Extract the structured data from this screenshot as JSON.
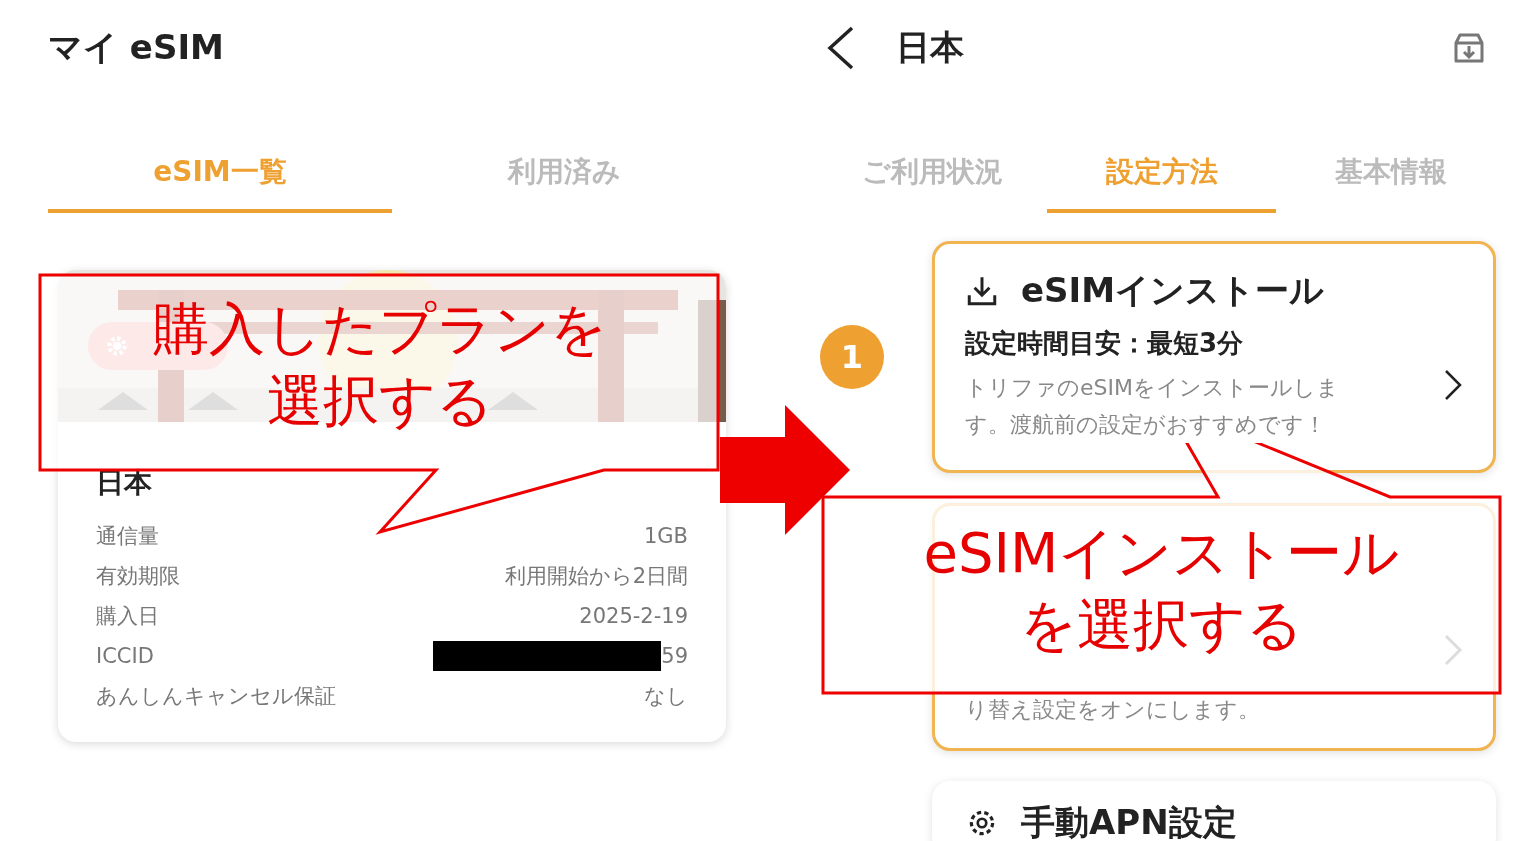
{
  "left": {
    "title": "マイ eSIM",
    "tabs": [
      {
        "label": "eSIM一覧",
        "selected": true
      },
      {
        "label": "利用済み",
        "selected": false
      }
    ],
    "plan_card": {
      "country": "日本",
      "rows": [
        {
          "kind": "text",
          "label": "通信量",
          "value": "1GB"
        },
        {
          "kind": "text",
          "label": "有効期限",
          "value": "利用開始から2日間"
        },
        {
          "kind": "text",
          "label": "購入日",
          "value": "2025-2-19"
        },
        {
          "kind": "redacted",
          "label": "ICCID",
          "value": "59"
        },
        {
          "kind": "text",
          "label": "あんしんキャンセル保証",
          "value": "なし"
        }
      ]
    }
  },
  "right": {
    "title": "日本",
    "tabs": [
      {
        "label": "ご利用状況",
        "selected": false
      },
      {
        "label": "設定方法",
        "selected": true
      },
      {
        "label": "基本情報",
        "selected": false
      }
    ],
    "steps": [
      {
        "kind": "install",
        "number": "1",
        "title": "eSIMインストール",
        "time": "設定時間目安：最短3分",
        "description": "トリファのeSIMをインストールします。渡航前の設定がおすすめです！",
        "highlighted": true
      },
      {
        "kind": "switch",
        "description": "り替え設定をオンにします。",
        "highlighted": true
      },
      {
        "kind": "apn",
        "title": "手動APN設定",
        "highlighted": false
      }
    ]
  },
  "callouts": [
    {
      "lines": [
        "購入したプランを",
        "選択する"
      ]
    },
    {
      "lines": [
        "eSIMインストール",
        "を選択する"
      ]
    }
  ]
}
